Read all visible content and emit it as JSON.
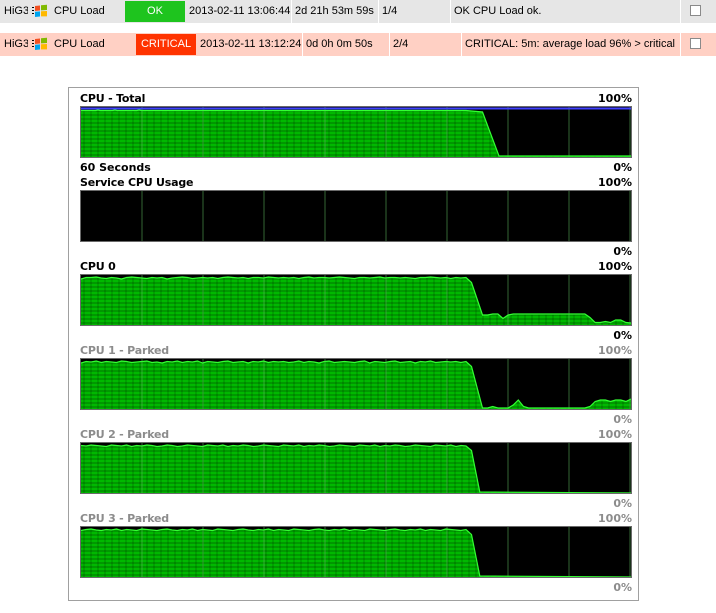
{
  "rows": [
    {
      "host": "HiG3",
      "service": "CPU Load",
      "state": "OK",
      "last_check": "2013-02-11 13:06:44",
      "duration": "2d 21h 53m 59s",
      "attempt": "1/4",
      "output": "OK CPU Load ok.",
      "state_color": "#1ec41e",
      "row_color": "#e6e6e6"
    },
    {
      "host": "HiG3",
      "service": "CPU Load",
      "state": "CRITICAL",
      "last_check": "2013-02-11 13:12:24",
      "duration": "0d 0h 0m 50s",
      "attempt": "2/4",
      "output": "CRITICAL: 5m: average load 96% > critical",
      "state_color": "#ff3300",
      "row_color": "#ffd0c4"
    }
  ],
  "graphs": [
    {
      "title": "CPU - Total",
      "max_label": "100%",
      "min_label": "0%",
      "footer_label": "60 Seconds",
      "parked": false,
      "values": [
        0.93,
        0.93,
        0.93,
        0.93,
        0.93,
        0.93,
        0.93,
        0.94,
        0.93,
        0.93,
        0.93,
        0.93,
        0.93,
        0.93,
        0.94,
        0.93,
        0.93,
        0.93,
        0.93,
        0.93,
        0.93,
        0.93,
        0.93,
        0.93,
        0.94,
        0.93,
        0.93,
        0.93,
        0.93,
        0.93,
        0.93,
        0.93,
        0.93,
        0.93,
        0.93,
        0.93,
        0.93,
        0.93,
        0.93,
        0.93,
        0.93,
        0.93,
        0.93,
        0.93,
        0.93,
        0.93,
        0.93,
        0.93,
        0.93,
        0.93,
        0.93,
        0.93,
        0.93,
        0.93,
        0.93,
        0.93,
        0.93,
        0.93,
        0.93,
        0.93,
        0.93,
        0.93,
        0.93,
        0.93,
        0.93,
        0.93,
        0.93,
        0.93,
        0.93,
        0.93,
        0.93,
        0.93,
        0.93,
        0.93,
        0.93,
        0.93,
        0.93,
        0.93,
        0.93,
        0.93,
        0.93,
        0.93,
        0.93,
        0.93,
        0.93,
        0.93,
        0.93,
        0.93,
        0.93,
        0.93,
        0.93,
        0.93,
        0.93,
        0.93,
        0.93,
        0.93,
        0.93,
        0.93,
        0.93,
        0.93,
        0.93,
        0.93,
        0.93,
        0.93,
        0.93,
        0.93,
        0.93,
        0.93,
        0.93,
        0.93,
        0.93,
        0.93,
        0.93,
        0.93,
        0.93,
        0.93,
        0.93,
        0.93,
        0.93,
        0.93,
        0.93,
        0.93,
        0.93,
        0.93,
        0.93,
        0.93,
        0.93,
        0.93,
        0.93,
        0.93,
        0.93,
        0.93,
        0.93,
        0.93,
        0.93,
        0.93,
        0.93,
        0.93,
        0.93,
        0.93,
        0.93,
        0.93,
        0.93,
        0.93,
        0.93,
        0.93,
        0.93,
        0.93,
        0.93,
        0.93,
        0.93,
        0.93,
        0.93,
        0.93,
        0.93,
        0.93,
        0.93,
        0.93,
        0.93,
        0.93
      ],
      "sharp_drop": [
        0.75,
        0.86,
        0.04
      ],
      "total_line": true
    },
    {
      "title": "Service CPU Usage",
      "max_label": "100%",
      "min_label": "0%",
      "parked": false,
      "values": [],
      "sharp_drop": null,
      "total_line": false
    },
    {
      "title": "CPU 0",
      "max_label": "100%",
      "min_label": "0%",
      "parked": false,
      "values": [
        0.92,
        0.95,
        0.95,
        0.96,
        0.94,
        0.93,
        0.95,
        0.94,
        0.92,
        0.95,
        0.96,
        0.95,
        0.94,
        0.93,
        0.95,
        0.94,
        0.95,
        0.92,
        0.94,
        0.95,
        0.96,
        0.95,
        0.93,
        0.94,
        0.95,
        0.94,
        0.95,
        0.93,
        0.95,
        0.96,
        0.95,
        0.94,
        0.95,
        0.93,
        0.95,
        0.95,
        0.94,
        0.96,
        0.95,
        0.94,
        0.95,
        0.94,
        0.95,
        0.93,
        0.95,
        0.96,
        0.94,
        0.95,
        0.95,
        0.94,
        0.95,
        0.96,
        0.95,
        0.94,
        0.93,
        0.95,
        0.95,
        0.94,
        0.95,
        0.96,
        0.94,
        0.95,
        0.95,
        0.94,
        0.95,
        0.94,
        0.93,
        0.95,
        0.95,
        0.96,
        0.95,
        0.94,
        0.95,
        0.93,
        0.95,
        0.94,
        0.95
      ],
      "tail": [
        0.2,
        0.2,
        0.22,
        0.22,
        0.13,
        0.2,
        0.22,
        0.22,
        0.22,
        0.22,
        0.22,
        0.22,
        0.22,
        0.22,
        0.22,
        0.22,
        0.22,
        0.22,
        0.22,
        0.22,
        0.22,
        0.15,
        0.05,
        0.05,
        0.07,
        0.05,
        0.1,
        0.1,
        0.05,
        0.04
      ],
      "total_line": false
    },
    {
      "title": "CPU 1 - Parked",
      "max_label": "100%",
      "min_label": "0%",
      "parked": true,
      "values": [
        0.92,
        0.95,
        0.94,
        0.96,
        0.93,
        0.95,
        0.94,
        0.93,
        0.96,
        0.95,
        0.93,
        0.94,
        0.95,
        0.96,
        0.93,
        0.94,
        0.92,
        0.95,
        0.94,
        0.96,
        0.93,
        0.95,
        0.94,
        0.96,
        0.92,
        0.95,
        0.94,
        0.93,
        0.95,
        0.96,
        0.93,
        0.94,
        0.95,
        0.92,
        0.95,
        0.94,
        0.96,
        0.93,
        0.95,
        0.94,
        0.95,
        0.93,
        0.94,
        0.96,
        0.93,
        0.95,
        0.94,
        0.92,
        0.95,
        0.96,
        0.93,
        0.94,
        0.95,
        0.94,
        0.93,
        0.95,
        0.96,
        0.92,
        0.95,
        0.94,
        0.93,
        0.95,
        0.96,
        0.93,
        0.94,
        0.95,
        0.92,
        0.95,
        0.94,
        0.96,
        0.93,
        0.94,
        0.95,
        0.94,
        0.95,
        0.93,
        0.95
      ],
      "tail": [
        0.02,
        0.02,
        0.05,
        0.02,
        0.02,
        0.02,
        0.08,
        0.18,
        0.05,
        0.02,
        0.02,
        0.02,
        0.02,
        0.02,
        0.02,
        0.02,
        0.02,
        0.02,
        0.02,
        0.02,
        0.02,
        0.05,
        0.15,
        0.18,
        0.18,
        0.15,
        0.18,
        0.18,
        0.15,
        0.2
      ],
      "total_line": false
    },
    {
      "title": "CPU 2 - Parked",
      "max_label": "100%",
      "min_label": "0%",
      "parked": true,
      "values": [
        0.95,
        0.94,
        0.96,
        0.95,
        0.94,
        0.93,
        0.96,
        0.95,
        0.94,
        0.96,
        0.93,
        0.95,
        0.94,
        0.96,
        0.95,
        0.93,
        0.94,
        0.96,
        0.95,
        0.93,
        0.94,
        0.96,
        0.95,
        0.94,
        0.93,
        0.96,
        0.95,
        0.94,
        0.96,
        0.93,
        0.95,
        0.94,
        0.96,
        0.95,
        0.93,
        0.94,
        0.96,
        0.95,
        0.94,
        0.93,
        0.96,
        0.95,
        0.94,
        0.96,
        0.93,
        0.95,
        0.94,
        0.96,
        0.95,
        0.93,
        0.94,
        0.96,
        0.95,
        0.94,
        0.93,
        0.96,
        0.95,
        0.94,
        0.96,
        0.93,
        0.95,
        0.94,
        0.96,
        0.95,
        0.93,
        0.94,
        0.96,
        0.95,
        0.94,
        0.93,
        0.96,
        0.95,
        0.94,
        0.96,
        0.93,
        0.95,
        0.94
      ],
      "tail": [],
      "total_line": false
    },
    {
      "title": "CPU 3 - Parked",
      "max_label": "100%",
      "min_label": "0%",
      "parked": true,
      "values": [
        0.93,
        0.95,
        0.96,
        0.94,
        0.93,
        0.95,
        0.94,
        0.96,
        0.93,
        0.95,
        0.94,
        0.93,
        0.96,
        0.95,
        0.94,
        0.93,
        0.95,
        0.96,
        0.94,
        0.93,
        0.95,
        0.94,
        0.96,
        0.93,
        0.95,
        0.94,
        0.93,
        0.96,
        0.95,
        0.94,
        0.93,
        0.95,
        0.96,
        0.94,
        0.93,
        0.95,
        0.94,
        0.96,
        0.93,
        0.95,
        0.94,
        0.93,
        0.96,
        0.95,
        0.94,
        0.93,
        0.95,
        0.96,
        0.94,
        0.93,
        0.95,
        0.94,
        0.96,
        0.93,
        0.95,
        0.94,
        0.93,
        0.96,
        0.95,
        0.94,
        0.93,
        0.95,
        0.96,
        0.94,
        0.93,
        0.95,
        0.94,
        0.96,
        0.93,
        0.95,
        0.94,
        0.93,
        0.96,
        0.95,
        0.94,
        0.93,
        0.95
      ],
      "tail": [],
      "total_line": false
    }
  ],
  "colors": {
    "graph_bg": "#000000",
    "fill": "#00b800",
    "line": "#33ff33",
    "grid": "#1d5c1d",
    "grid_major": "#3a3a3a",
    "total_line": "#4040ff"
  }
}
